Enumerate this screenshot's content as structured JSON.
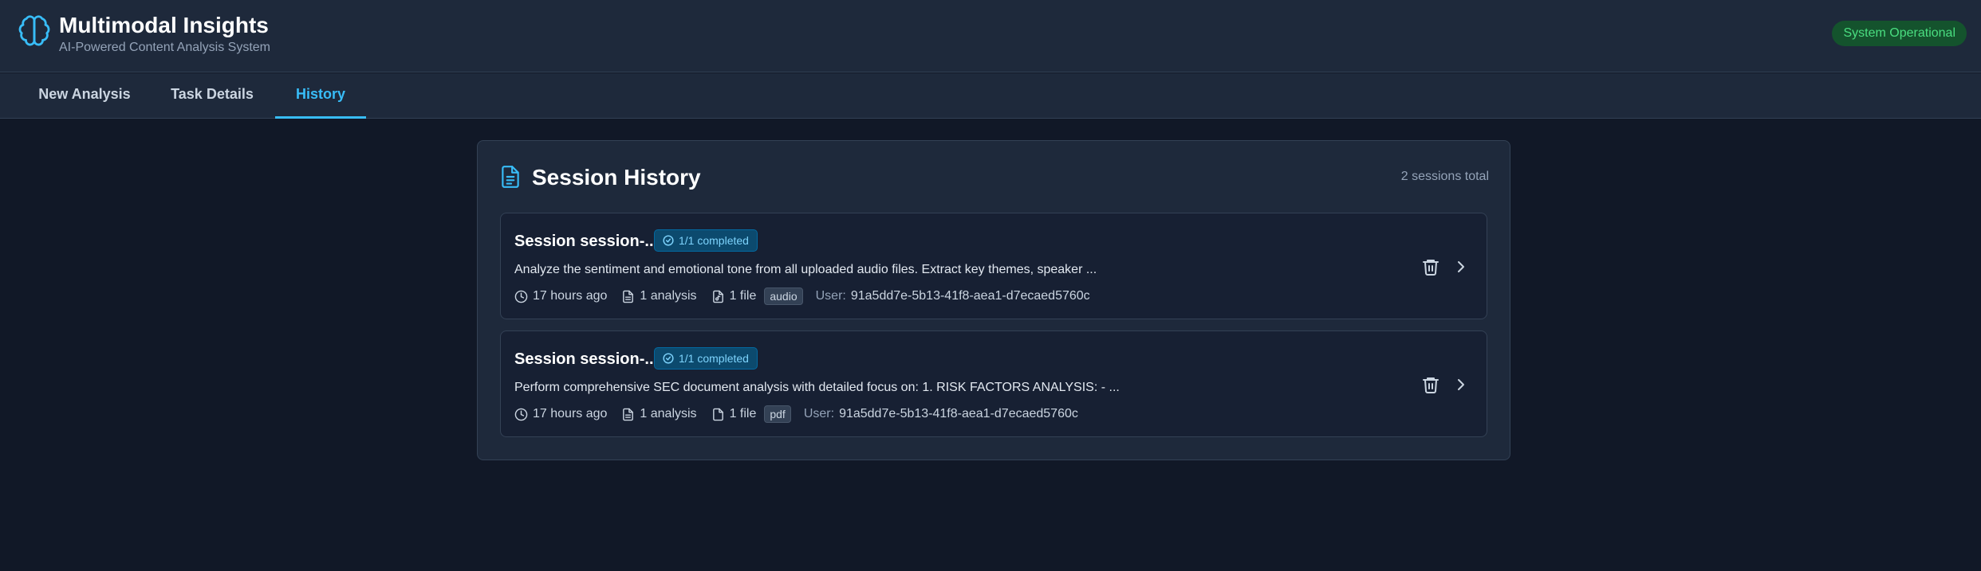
{
  "app": {
    "title": "Multimodal Insights",
    "subtitle": "AI-Powered Content Analysis System",
    "status": "System Operational",
    "icon": "brain-icon"
  },
  "tabs": [
    {
      "label": "New Analysis",
      "active": false
    },
    {
      "label": "Task Details",
      "active": false
    },
    {
      "label": "History",
      "active": true
    }
  ],
  "history": {
    "title": "Session History",
    "count": "2 sessions total",
    "icon": "document-icon",
    "sessions": [
      {
        "title": "Session session-...",
        "status": "1/1 completed",
        "description": "Analyze the sentiment and emotional tone from all uploaded audio files. Extract key themes, speaker ...",
        "time": "17 hours ago",
        "analyses": "1 analysis",
        "files": "1 file",
        "file_type": "audio",
        "user_label": "User:",
        "user_id": "91a5dd7e-5b13-41f8-aea1-d7ecaed5760c"
      },
      {
        "title": "Session session-...",
        "status": "1/1 completed",
        "description": "Perform comprehensive SEC document analysis with detailed focus on: 1. RISK FACTORS ANALYSIS: - ...",
        "time": "17 hours ago",
        "analyses": "1 analysis",
        "files": "1 file",
        "file_type": "pdf",
        "user_label": "User:",
        "user_id": "91a5dd7e-5b13-41f8-aea1-d7ecaed5760c"
      }
    ]
  },
  "colors": {
    "accent": "#38bdf8",
    "background": "#111827",
    "surface": "#1e293b",
    "success": "#4ade80"
  }
}
